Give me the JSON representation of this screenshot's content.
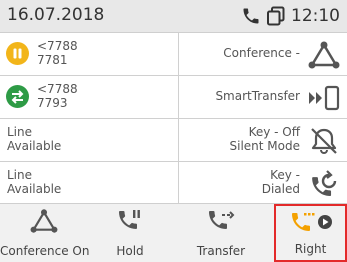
{
  "status": {
    "date": "16.07.2018",
    "time": "12:10"
  },
  "lines": [
    {
      "line1": "<7788",
      "line2": "7781"
    },
    {
      "line1": "<7788",
      "line2": "7793"
    },
    {
      "line1": "Line",
      "line2": "Available"
    },
    {
      "line1": "Line",
      "line2": "Available"
    }
  ],
  "keys": [
    {
      "label": "Conference -",
      "icon": "conference-icon"
    },
    {
      "label": "SmartTransfer",
      "icon": "smart-transfer-icon"
    },
    {
      "line1": "Key - Off",
      "line2": "Silent Mode",
      "icon": "bell-off-icon"
    },
    {
      "line1": "Key -",
      "line2": "Dialed",
      "icon": "redial-icon"
    }
  ],
  "softkeys": [
    {
      "label": "Conference On",
      "icon": "conference-icon"
    },
    {
      "label": "Hold",
      "icon": "hold-icon"
    },
    {
      "label": "Transfer",
      "icon": "transfer-icon"
    },
    {
      "label": "Right",
      "icon": "right-icon"
    }
  ],
  "colors": {
    "hold_badge": "#f2b51a",
    "transfer_badge": "#2e9b46",
    "accent": "#f4a100",
    "highlight": "#e32a2a"
  }
}
